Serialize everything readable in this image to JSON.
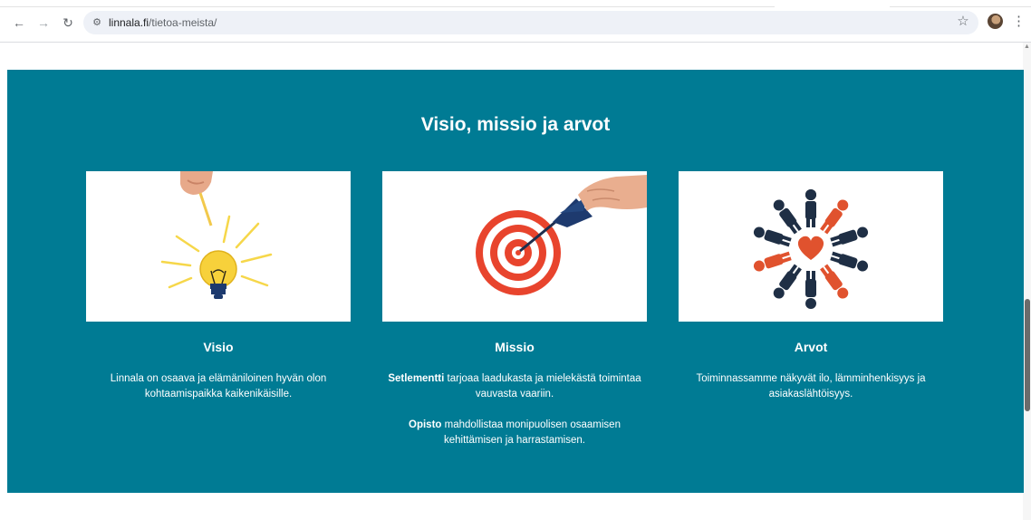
{
  "browser": {
    "url_host": "linnala.fi",
    "url_path": "/tietoa-meista/",
    "back_icon": "arrow-left-icon",
    "forward_icon": "arrow-right-icon",
    "reload_icon": "reload-icon",
    "site_info_icon": "tune-icon",
    "bookmark_icon": "star-icon",
    "menu_icon": "kebab-menu-icon"
  },
  "section": {
    "title": "Visio, missio ja arvot",
    "background": "#007b94",
    "cards": [
      {
        "title": "Visio",
        "image": "lightbulb-illustration",
        "text": "Linnala on osaava ja elämäniloinen hyvän olon kohtaamispaikka kaikenikäisille."
      },
      {
        "title": "Missio",
        "image": "dart-target-photo",
        "p1_strong": "Setlementti",
        "p1_rest": " tarjoaa laadukasta ja mielekästä toimintaa vauvasta vaariin.",
        "p2_strong": "Opisto",
        "p2_rest": " mahdollistaa monipuolisen osaamisen kehittämisen ja harrastamisen."
      },
      {
        "title": "Arvot",
        "image": "people-circle-heart-illustration",
        "text": "Toiminnassamme näkyvät ilo, lämminhenkisyys ja asiakaslähtöisyys."
      }
    ]
  }
}
